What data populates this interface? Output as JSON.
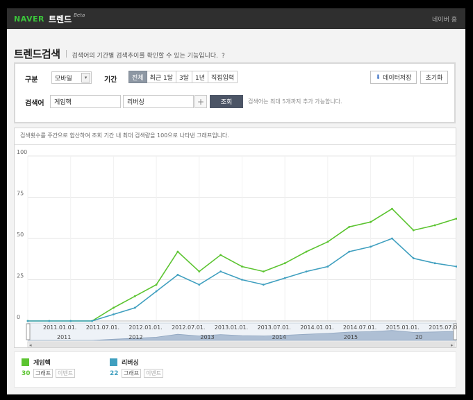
{
  "header": {
    "brand": "NAVER",
    "service": "트렌드",
    "beta": "Beta",
    "home_link": "네이버 홈"
  },
  "page": {
    "title": "트렌드검색",
    "description": "검색어의 기간별 검색추이를 확인할 수 있는 기능입니다.",
    "help": "?"
  },
  "search": {
    "category_label": "구분",
    "category_value": "모바일",
    "period_label": "기간",
    "periods": [
      "전체",
      "최근 1달",
      "3달",
      "1년",
      "직접입력"
    ],
    "active_period": "전체",
    "download_label": "데이터저장",
    "reset_label": "초기화",
    "keyword_label": "검색어",
    "keyword1": "게임핵",
    "keyword2": "리버싱",
    "add_label": "+",
    "submit_label": "조회",
    "hint": "검색어는 최대 5개까지 추가 가능합니다."
  },
  "panel": {
    "note": "검색횟수를 주간으로 합산하여 조회 기간 내 최대 검색량을 100으로 나타낸 그래프입니다."
  },
  "chart_data": {
    "type": "line",
    "y_ticks": [
      "0",
      "25",
      "50",
      "75",
      "100"
    ],
    "ylim": [
      0,
      100
    ],
    "grid": true,
    "x_tick_labels": [
      "2011.01.01.",
      "2011.07.01.",
      "2012.01.01.",
      "2012.07.01.",
      "2013.01.01.",
      "2013.07.01.",
      "2014.01.01.",
      "2014.07.01.",
      "2015.01.01.",
      "2015.07.01."
    ],
    "year_labels": [
      "2011",
      "2012",
      "2013",
      "2014",
      "2015",
      "20"
    ],
    "x": [
      "2010.10",
      "2011.01",
      "2011.04",
      "2011.07",
      "2011.10",
      "2012.01",
      "2012.04",
      "2012.07",
      "2012.10",
      "2013.01",
      "2013.04",
      "2013.07",
      "2013.10",
      "2014.01",
      "2014.04",
      "2014.07",
      "2014.10",
      "2015.01",
      "2015.04",
      "2015.07",
      "2015.10"
    ],
    "series": [
      {
        "name": "게임핵",
        "color": "#5cc431",
        "values": [
          0,
          0,
          0,
          0,
          8,
          15,
          22,
          42,
          30,
          40,
          33,
          30,
          35,
          42,
          48,
          57,
          60,
          68,
          55,
          58,
          62
        ]
      },
      {
        "name": "리버싱",
        "color": "#3f9fbf",
        "values": [
          0,
          0,
          0,
          0,
          4,
          8,
          18,
          28,
          22,
          30,
          25,
          22,
          26,
          30,
          33,
          42,
          45,
          50,
          38,
          35,
          33
        ]
      }
    ]
  },
  "legend": {
    "items": [
      {
        "name": "게임핵",
        "value": "30",
        "color": "#5cc431",
        "graph_label": "그래프",
        "event_label": "이벤트"
      },
      {
        "name": "리버싱",
        "value": "22",
        "color": "#3f9fbf",
        "graph_label": "그래프",
        "event_label": "이벤트"
      }
    ]
  }
}
